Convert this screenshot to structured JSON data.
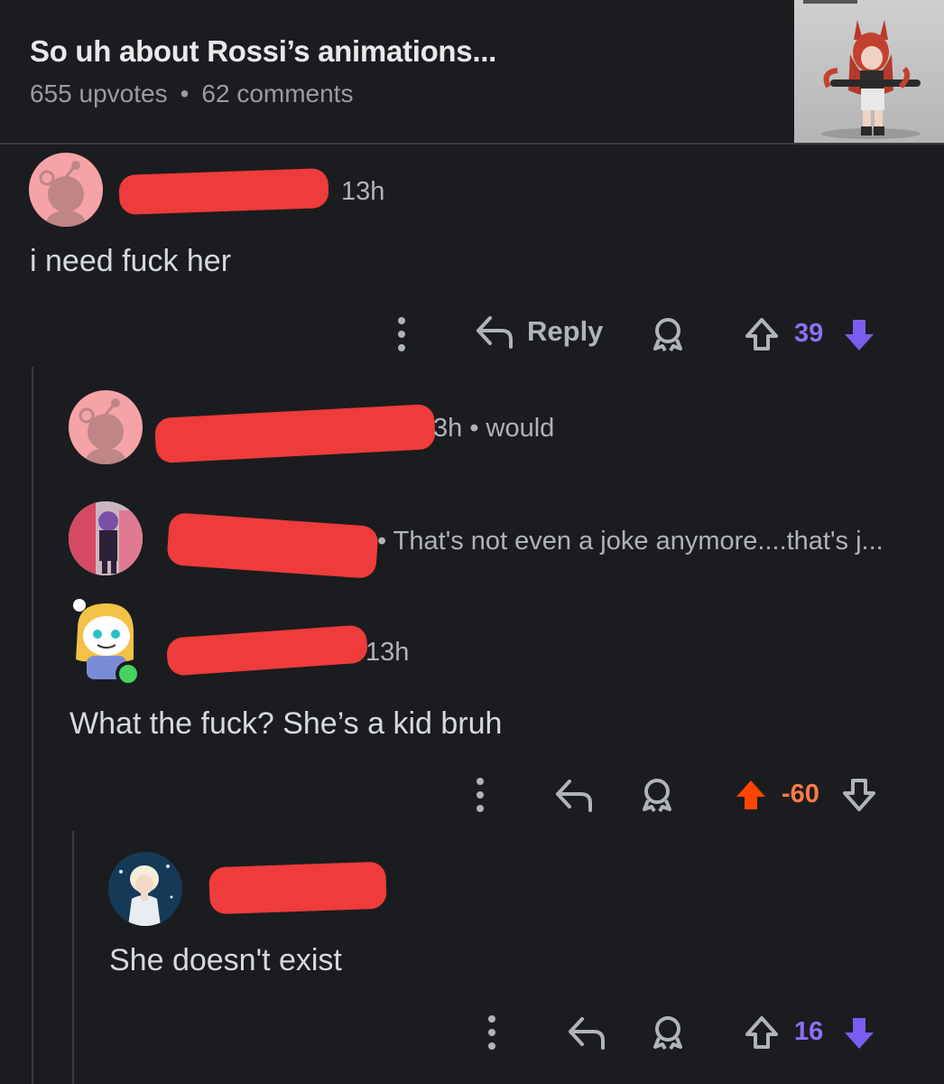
{
  "post": {
    "title": "So uh about Rossi’s animations...",
    "upvotes": "655 upvotes",
    "separator": "•",
    "comments": "62 comments"
  },
  "comments": [
    {
      "age": "13h",
      "body": "i need fuck her",
      "reply_label": "Reply",
      "score": "39",
      "vote_color": "#7a5cf0"
    },
    {
      "age": "3h • would"
    },
    {
      "preview": "• That's not even a joke anymore....that's j..."
    },
    {
      "age": "13h",
      "body": "What the fuck? She’s a kid bruh",
      "score": "-60",
      "vote_color": "#ff4500",
      "score_color": "#ff7a45"
    },
    {
      "body": "She doesn't exist",
      "score": "16",
      "vote_color": "#7a5cf0"
    }
  ],
  "colors": {
    "background": "#1b1c1f",
    "redaction": "#ee3b3b",
    "upvote_accent": "#7a5cf0",
    "downvote_accent": "#ff4500"
  }
}
